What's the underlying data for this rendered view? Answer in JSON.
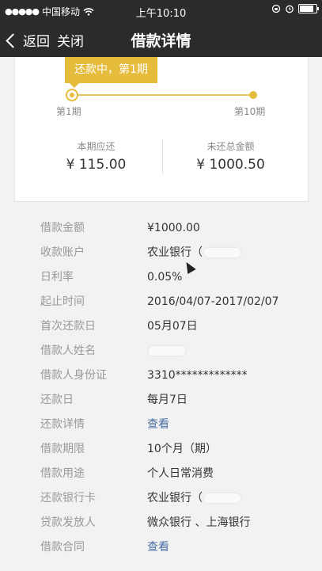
{
  "status_bar": {
    "signal": "●●●●●",
    "carrier": "中国移动",
    "wifi": "wifi-icon",
    "time": "上午10:10",
    "battery_level": 0.85
  },
  "nav": {
    "back_label": "返回",
    "close_label": "关闭",
    "title": "借款详情"
  },
  "progress": {
    "badge": "还款中，第1期",
    "start_label": "第1期",
    "end_label": "第10期",
    "accent": "#e6bc3c"
  },
  "summary": {
    "current_label": "本期应还",
    "current_value": "¥ 115.00",
    "remaining_label": "未还总金额",
    "remaining_value": "¥ 1000.50"
  },
  "details": [
    {
      "label": "借款金额",
      "value": "¥1000.00"
    },
    {
      "label": "收款账户",
      "value": "农业银行（"
    },
    {
      "label": "日利率",
      "value": "0.05%"
    },
    {
      "label": "起止时间",
      "value": "2016/04/07-2017/02/07"
    },
    {
      "label": "首次还款日",
      "value": "05月07日"
    },
    {
      "label": "借款人姓名",
      "value": ""
    },
    {
      "label": "借款人身份证",
      "value": "3310*************"
    },
    {
      "label": "还款日",
      "value": "每月7日"
    },
    {
      "label": "还款详情",
      "value": "查看"
    },
    {
      "label": "借款期限",
      "value": "10个月（期）"
    },
    {
      "label": "借款用途",
      "value": "个人日常消费"
    },
    {
      "label": "还款银行卡",
      "value": "农业银行（"
    },
    {
      "label": "贷款发放人",
      "value": "微众银行 、上海银行"
    },
    {
      "label": "借款合同",
      "value": "查看"
    }
  ]
}
